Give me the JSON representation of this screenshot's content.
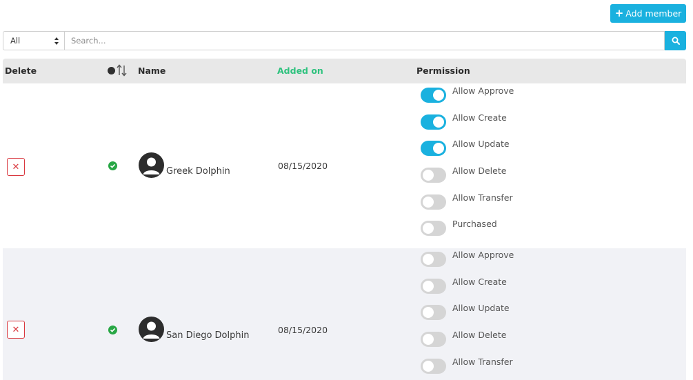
{
  "toolbar": {
    "add_member_label": "Add member"
  },
  "filter": {
    "selected": "All",
    "search_placeholder": "Search..."
  },
  "table": {
    "headers": {
      "delete": "Delete",
      "name": "Name",
      "added_on": "Added on",
      "permission": "Permission"
    },
    "rows": [
      {
        "name": "Greek Dolphin",
        "added_on": "08/15/2020",
        "permissions": [
          {
            "label": "Allow Approve",
            "enabled": true
          },
          {
            "label": "Allow Create",
            "enabled": true
          },
          {
            "label": "Allow Update",
            "enabled": true
          },
          {
            "label": "Allow Delete",
            "enabled": false
          },
          {
            "label": "Allow Transfer",
            "enabled": false
          },
          {
            "label": "Purchased",
            "enabled": false
          }
        ]
      },
      {
        "name": "San Diego Dolphin",
        "added_on": "08/15/2020",
        "permissions": [
          {
            "label": "Allow Approve",
            "enabled": false
          },
          {
            "label": "Allow Create",
            "enabled": false
          },
          {
            "label": "Allow Update",
            "enabled": false
          },
          {
            "label": "Allow Delete",
            "enabled": false
          },
          {
            "label": "Allow Transfer",
            "enabled": false
          }
        ]
      }
    ]
  },
  "colors": {
    "accent": "#1ab1df",
    "success": "#28a745",
    "danger": "#d9383f",
    "added_header": "#2ec27e"
  }
}
